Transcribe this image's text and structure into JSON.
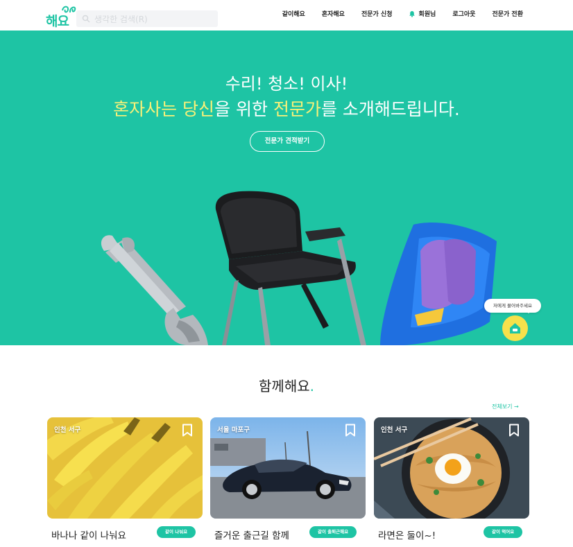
{
  "header": {
    "logo": "해요",
    "search_placeholder": "생각한 검색(R)",
    "nav": [
      {
        "label": "같이해요"
      },
      {
        "label": "혼자해요"
      },
      {
        "label": "전문가 신청"
      },
      {
        "label": "회원님",
        "icon": "bell-icon"
      },
      {
        "label": "로그아웃"
      },
      {
        "label": "전문가 전환"
      }
    ]
  },
  "hero": {
    "line1": "수리! 청소! 이사!",
    "line2_parts": [
      "혼자사는 당신",
      "을 위한 ",
      "전문가",
      "를 소개해드립니다."
    ],
    "cta": "전문가 견적받기",
    "chat_bubble": "저에게 물어봐주세요",
    "chat_icon": "house-chat-icon",
    "colors": {
      "background": "#1ec4a4",
      "highlight": "#f9f178"
    }
  },
  "section": {
    "title": "함께해요",
    "title_dot": ".",
    "see_all": "전체보기 →"
  },
  "cards": [
    {
      "location": "인천 서구",
      "title": "바나나 같이 나눠요",
      "button": "같이 나눠요",
      "image": "bananas"
    },
    {
      "location": "서울 마포구",
      "title": "즐거운 출근길 함께",
      "button": "같이 출퇴근해요",
      "image": "car"
    },
    {
      "location": "인천 서구",
      "title": "라면은 둘이~!",
      "button": "같이 먹어요",
      "image": "ramen"
    }
  ]
}
